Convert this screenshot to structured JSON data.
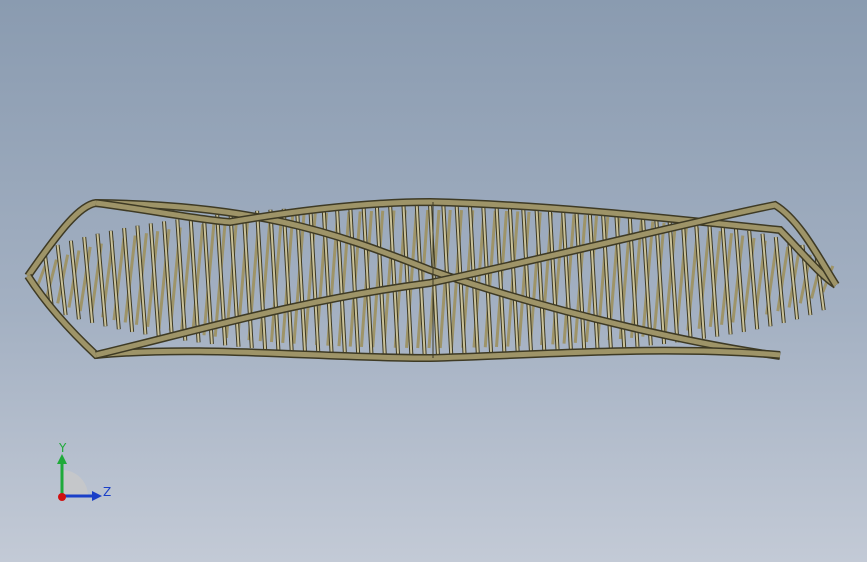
{
  "view": {
    "background_top": "#8a9bb0",
    "background_bottom": "#c3cad6",
    "model_color": "#9e9468",
    "model_edge_color": "#3e3a24",
    "model_highlight": "#c9c199"
  },
  "triad": {
    "y_label": "Y",
    "z_label": "Z",
    "y_color": "#1faa3a",
    "z_color": "#1a3fc8",
    "x_color": "#d01010"
  }
}
